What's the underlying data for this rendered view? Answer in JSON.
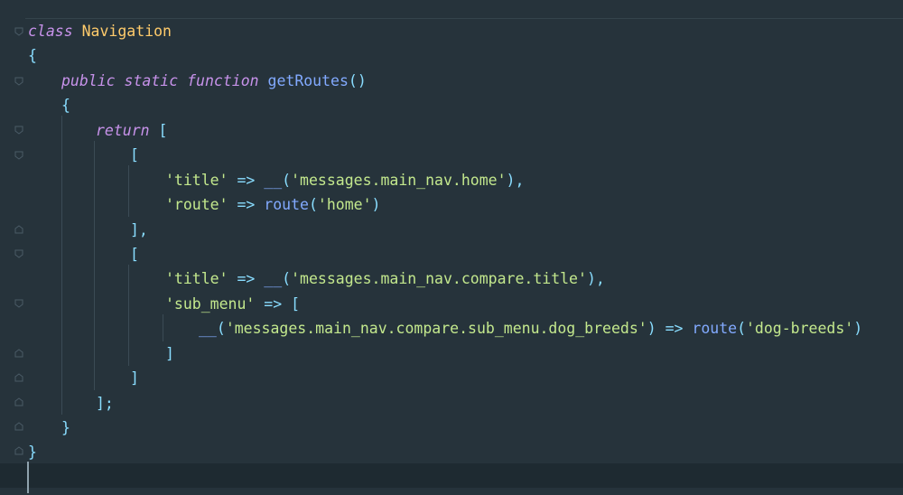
{
  "editor": {
    "language": "php",
    "theme_colors": {
      "background": "#26333b",
      "keyword": "#c792ea",
      "class_name": "#ffcb6b",
      "function": "#82aaff",
      "string": "#c3e88d",
      "punctuation": "#89ddff",
      "current_line": "#1e2a31"
    },
    "code": {
      "l1": {
        "kw": "class",
        "name": "Navigation"
      },
      "l2": {
        "brace": "{"
      },
      "l3": {
        "kw1": "public",
        "kw2": "static",
        "kw3": "function",
        "fn": "getRoutes",
        "parens": "()"
      },
      "l4": {
        "brace": "{"
      },
      "l5": {
        "kw": "return",
        "bracket": "["
      },
      "l6": {
        "bracket": "["
      },
      "l7": {
        "key": "'title'",
        "arrow": "=>",
        "fn": "__",
        "open": "(",
        "arg": "'messages.main_nav.home'",
        "close": "),"
      },
      "l8": {
        "key": "'route'",
        "arrow": "=>",
        "fn": "route",
        "open": "(",
        "arg": "'home'",
        "close": ")"
      },
      "l9": {
        "bracket": "],"
      },
      "l10": {
        "bracket": "["
      },
      "l11": {
        "key": "'title'",
        "arrow": "=>",
        "fn": "__",
        "open": "(",
        "arg": "'messages.main_nav.compare.title'",
        "close": "),"
      },
      "l12": {
        "key": "'sub_menu'",
        "arrow": "=>",
        "bracket": "["
      },
      "l13": {
        "fn": "__",
        "open": "(",
        "arg": "'messages.main_nav.compare.sub_menu.dog_breeds'",
        "close": ")",
        "arrow": "=>",
        "fn2": "route",
        "open2": "(",
        "arg2": "'dog-breeds'",
        "close2": ")"
      },
      "l14": {
        "bracket": "]"
      },
      "l15": {
        "bracket": "]"
      },
      "l16": {
        "bracket": "];"
      },
      "l17": {
        "brace": "}"
      },
      "l18": {
        "brace": "}"
      }
    }
  }
}
